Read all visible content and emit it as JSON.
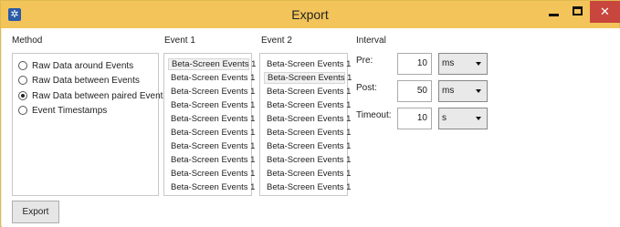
{
  "window": {
    "title": "Export",
    "app_icon": "✲",
    "minimize_icon": "minimize-icon",
    "maximize_icon": "maximize-icon",
    "close_icon": "close-icon",
    "close_glyph": "✕",
    "titlebar_color": "#f3c45a",
    "close_color": "#c8463d"
  },
  "method": {
    "label": "Method",
    "options": [
      {
        "label": "Raw Data around Events",
        "checked": false
      },
      {
        "label": "Raw Data between Events",
        "checked": false
      },
      {
        "label": "Raw Data between paired Events",
        "checked": true
      },
      {
        "label": "Event Timestamps",
        "checked": false
      }
    ]
  },
  "event1": {
    "label": "Event 1",
    "items": [
      "Beta-Screen Events 1",
      "Beta-Screen Events 1",
      "Beta-Screen Events 1",
      "Beta-Screen Events 1",
      "Beta-Screen Events 1",
      "Beta-Screen Events 1",
      "Beta-Screen Events 1",
      "Beta-Screen Events 1",
      "Beta-Screen Events 1",
      "Beta-Screen Events 1"
    ],
    "selected_index": 0
  },
  "event2": {
    "label": "Event 2",
    "items": [
      "Beta-Screen Events 1",
      "Beta-Screen Events 1",
      "Beta-Screen Events 1",
      "Beta-Screen Events 1",
      "Beta-Screen Events 1",
      "Beta-Screen Events 1",
      "Beta-Screen Events 1",
      "Beta-Screen Events 1",
      "Beta-Screen Events 1",
      "Beta-Screen Events 1"
    ],
    "selected_index": 1
  },
  "interval": {
    "label": "Interval",
    "pre": {
      "label": "Pre:",
      "value": "10",
      "unit": "ms"
    },
    "post": {
      "label": "Post:",
      "value": "50",
      "unit": "ms"
    },
    "timeout": {
      "label": "Timeout:",
      "value": "10",
      "unit": "s"
    }
  },
  "footer": {
    "export_label": "Export"
  }
}
